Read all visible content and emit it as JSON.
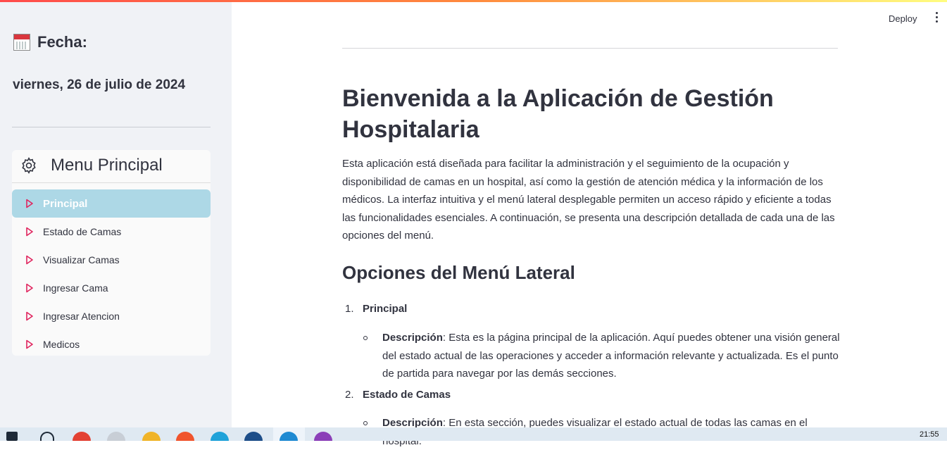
{
  "sidebar": {
    "fecha_label": "Fecha:",
    "fecha_icon": "calendar-icon",
    "date": "viernes, 26 de julio de 2024",
    "menu": {
      "title": "Menu Principal",
      "icon": "gear-icon",
      "items": [
        {
          "label": "Principal",
          "active": true
        },
        {
          "label": "Estado de Camas",
          "active": false
        },
        {
          "label": "Visualizar Camas",
          "active": false
        },
        {
          "label": "Ingresar Cama",
          "active": false
        },
        {
          "label": "Ingresar Atencion",
          "active": false
        },
        {
          "label": "Medicos",
          "active": false
        }
      ],
      "active_color": "#add8e6",
      "icon_color": "#e0245e"
    }
  },
  "header": {
    "deploy_label": "Deploy",
    "menu_icon": "kebab-menu-icon"
  },
  "main": {
    "title": "Bienvenida a la Aplicación de Gestión Hospitalaria",
    "intro": "Esta aplicación está diseñada para facilitar la administración y el seguimiento de la ocupación y disponibilidad de camas en un hospital, así como la gestión de atención médica y la información de los médicos. La interfaz intuitiva y el menú lateral desplegable permiten un acceso rápido y eficiente a todas las funcionalidades esenciales. A continuación, se presenta una descripción detallada de cada una de las opciones del menú.",
    "section_title": "Opciones del Menú Lateral",
    "options": [
      {
        "number": "1.",
        "title": "Principal",
        "desc_label": "Descripción",
        "desc_text": ": Esta es la página principal de la aplicación. Aquí puedes obtener una visión general del estado actual de las operaciones y acceder a información relevante y actualizada. Es el punto de partida para navegar por las demás secciones."
      },
      {
        "number": "2.",
        "title": "Estado de Camas",
        "desc_label": "Descripción",
        "desc_text": ": En esta sección, puedes visualizar el estado actual de todas las camas en el hospital."
      }
    ]
  },
  "taskbar": {
    "clock": "21:55"
  },
  "colors": {
    "text": "#31333f",
    "sidebar_bg": "#f0f2f6"
  }
}
